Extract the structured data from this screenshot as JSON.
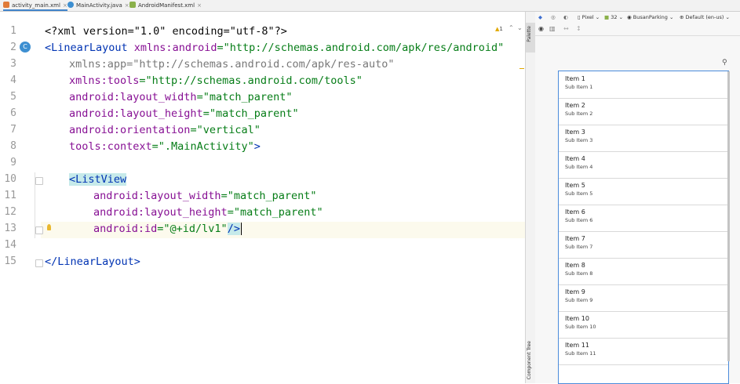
{
  "tabs": [
    {
      "label": "activity_main.xml",
      "icon": "xml-layout-icon",
      "active": true
    },
    {
      "label": "MainActivity.java",
      "icon": "java-class-icon",
      "active": false
    },
    {
      "label": "AndroidManifest.xml",
      "icon": "android-manifest-icon",
      "active": false
    }
  ],
  "editor": {
    "inspection_count": "1",
    "line_numbers": [
      "1",
      "2",
      "3",
      "4",
      "5",
      "6",
      "7",
      "8",
      "9",
      "10",
      "11",
      "12",
      "13",
      "14",
      "15"
    ],
    "lines": {
      "l1_decl": "<?xml version=\"1.0\" encoding=\"utf-8\"?>",
      "l2_open": "<LinearLayout ",
      "l2_attr": "xmlns:android",
      "l2_val": "=\"http://schemas.android.com/apk/res/android\"",
      "l3": "xmlns:app=\"http://schemas.android.com/apk/res-auto\"",
      "l4_attr": "xmlns:tools",
      "l4_val": "=\"http://schemas.android.com/tools\"",
      "l5_attr": "android:layout_width",
      "l5_val": "=\"match_parent\"",
      "l6_attr": "android:layout_height",
      "l6_val": "=\"match_parent\"",
      "l7_attr": "android:orientation",
      "l7_val": "=\"vertical\"",
      "l8_attr": "tools:context",
      "l8_val": "=\".MainActivity\"",
      "l8_end": ">",
      "l10": "<ListView",
      "l11_attr": "android:layout_width",
      "l11_val": "=\"match_parent\"",
      "l12_attr": "android:layout_height",
      "l12_val": "=\"match_parent\"",
      "l13_attr": "android:id",
      "l13_val": "=\"@+id/lv1\"",
      "l13_end": "/>",
      "l15": "</LinearLayout>"
    }
  },
  "side_labels": {
    "palette": "Palette",
    "component_tree": "Component Tree"
  },
  "design_toolbar": {
    "device": "Pixel",
    "api": "32",
    "theme": "BusanParking",
    "locale": "Default (en-us)"
  },
  "list_items": [
    {
      "title": "Item 1",
      "subtitle": "Sub Item 1"
    },
    {
      "title": "Item 2",
      "subtitle": "Sub Item 2"
    },
    {
      "title": "Item 3",
      "subtitle": "Sub Item 3"
    },
    {
      "title": "Item 4",
      "subtitle": "Sub Item 4"
    },
    {
      "title": "Item 5",
      "subtitle": "Sub Item 5"
    },
    {
      "title": "Item 6",
      "subtitle": "Sub Item 6"
    },
    {
      "title": "Item 7",
      "subtitle": "Sub Item 7"
    },
    {
      "title": "Item 8",
      "subtitle": "Sub Item 8"
    },
    {
      "title": "Item 9",
      "subtitle": "Sub Item 9"
    },
    {
      "title": "Item 10",
      "subtitle": "Sub Item 10"
    },
    {
      "title": "Item 11",
      "subtitle": "Sub Item 11"
    }
  ],
  "colors": {
    "accent": "#4083c9",
    "tag": "#0033b3",
    "attribute": "#871094",
    "value": "#067d17"
  }
}
